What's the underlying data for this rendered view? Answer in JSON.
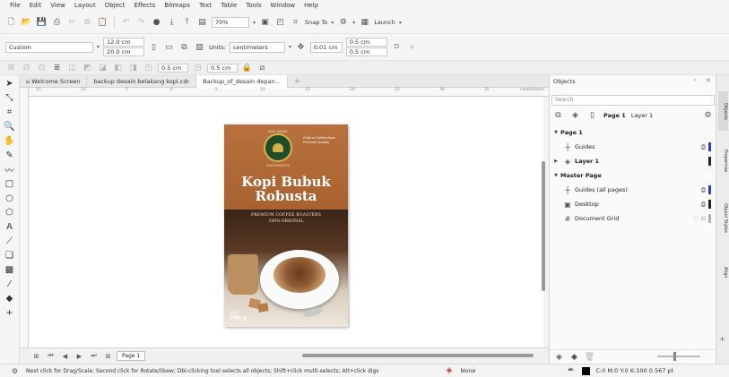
{
  "menu": [
    "File",
    "Edit",
    "View",
    "Layout",
    "Object",
    "Effects",
    "Bitmaps",
    "Text",
    "Table",
    "Tools",
    "Window",
    "Help"
  ],
  "toolbar1": {
    "zoom": "70%",
    "snap_to": "Snap To",
    "launch": "Launch"
  },
  "toolbar2": {
    "page_preset": "Custom",
    "width": "12.0 cm",
    "height": "20.0 cm",
    "units_label": "Units:",
    "units": "centimeters",
    "nudge": "0.01 cm",
    "dup_x": "0.5 cm",
    "dup_y": "0.5 cm"
  },
  "toolbar3": {
    "value1": "0.5 cm",
    "value2": "0.5 cm"
  },
  "doc_tabs": [
    {
      "label": "Welcome Screen"
    },
    {
      "label": "backup desain belakang kopi.cdr"
    },
    {
      "label": "Backup_of_desain depan..."
    }
  ],
  "ruler": {
    "unit": "centimeters",
    "ticks": [
      "15",
      "10",
      "5",
      "0",
      "5",
      "10",
      "15",
      "20",
      "25",
      "30",
      "35"
    ]
  },
  "artwork": {
    "badge_top": "KOPI BUBUK",
    "badge_bottom": "KOPI ROBUSTA",
    "tagline": "Original Coffee Bean Premium Quality",
    "title_line1": "Kopi Bubuk",
    "title_line2": "Robusta",
    "subtitle1": "PREMIUM COFFEE ROASTERS",
    "subtitle2": "100% ORIGINAL",
    "weight_label": "Netto",
    "weight": "200 g"
  },
  "page_nav": {
    "page_tab": "Page 1"
  },
  "status": {
    "hint": "Next click for Drag/Scale; Second click for Rotate/Skew; Dbl-clicking tool selects all objects; Shift+click multi-selects; Alt+click digs",
    "fill": "None",
    "outline": "C:0 M:0 Y:0 K:100  0.567 pt"
  },
  "objects_docker": {
    "title": "Objects",
    "search_placeholder": "Search",
    "current_page": "Page 1",
    "current_layer": "Layer 1",
    "rows": [
      {
        "label": "Page 1",
        "bold": true
      },
      {
        "label": "Guides"
      },
      {
        "label": "Layer 1",
        "bold": true
      },
      {
        "label": "Master Page",
        "bold": true
      },
      {
        "label": "Guides (all pages)"
      },
      {
        "label": "Desktop"
      },
      {
        "label": "Document Grid"
      }
    ],
    "colors": {
      "guides": "#2244cc",
      "layer1": "#222222",
      "desktop": "#222222",
      "grid": "#b0b0b0"
    }
  },
  "side_tabs": [
    "Objects",
    "Properties",
    "Object Styles",
    "Align"
  ],
  "colors": {
    "art_top": "#b8713e",
    "art_dark": "#3a2416",
    "badge": "#1f4d2a",
    "gold": "#d8b04a"
  }
}
